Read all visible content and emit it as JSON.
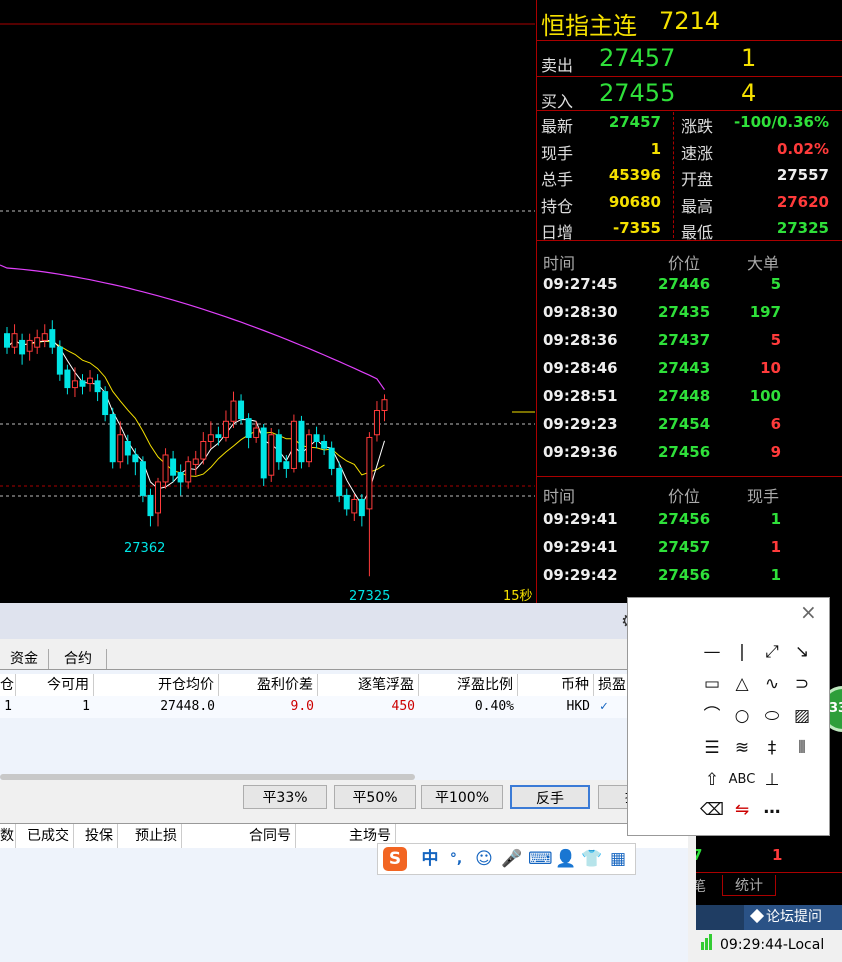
{
  "chart": {
    "labels": {
      "low1": "27362",
      "low2": "27325",
      "period": "15秒"
    },
    "candles": [
      {
        "o": 27505,
        "c": 27495,
        "h": 27510,
        "l": 27490
      },
      {
        "o": 27495,
        "c": 27505,
        "h": 27512,
        "l": 27490
      },
      {
        "o": 27500,
        "c": 27490,
        "h": 27505,
        "l": 27482
      },
      {
        "o": 27492,
        "c": 27500,
        "h": 27505,
        "l": 27485
      },
      {
        "o": 27495,
        "c": 27502,
        "h": 27508,
        "l": 27490
      },
      {
        "o": 27500,
        "c": 27505,
        "h": 27512,
        "l": 27495
      },
      {
        "o": 27508,
        "c": 27495,
        "h": 27515,
        "l": 27490
      },
      {
        "o": 27495,
        "c": 27475,
        "h": 27500,
        "l": 27470
      },
      {
        "o": 27478,
        "c": 27465,
        "h": 27482,
        "l": 27460
      },
      {
        "o": 27465,
        "c": 27470,
        "h": 27480,
        "l": 27458
      },
      {
        "o": 27470,
        "c": 27466,
        "h": 27475,
        "l": 27460
      },
      {
        "o": 27468,
        "c": 27472,
        "h": 27478,
        "l": 27462
      },
      {
        "o": 27470,
        "c": 27462,
        "h": 27475,
        "l": 27455
      },
      {
        "o": 27462,
        "c": 27445,
        "h": 27466,
        "l": 27440
      },
      {
        "o": 27445,
        "c": 27410,
        "h": 27450,
        "l": 27405
      },
      {
        "o": 27410,
        "c": 27430,
        "h": 27440,
        "l": 27405
      },
      {
        "o": 27425,
        "c": 27415,
        "h": 27430,
        "l": 27408
      },
      {
        "o": 27415,
        "c": 27410,
        "h": 27420,
        "l": 27400
      },
      {
        "o": 27410,
        "c": 27385,
        "h": 27414,
        "l": 27380
      },
      {
        "o": 27385,
        "c": 27370,
        "h": 27390,
        "l": 27362
      },
      {
        "o": 27372,
        "c": 27395,
        "h": 27398,
        "l": 27362
      },
      {
        "o": 27395,
        "c": 27415,
        "h": 27420,
        "l": 27390
      },
      {
        "o": 27412,
        "c": 27400,
        "h": 27418,
        "l": 27395
      },
      {
        "o": 27402,
        "c": 27395,
        "h": 27408,
        "l": 27385
      },
      {
        "o": 27395,
        "c": 27410,
        "h": 27414,
        "l": 27390
      },
      {
        "o": 27408,
        "c": 27412,
        "h": 27418,
        "l": 27400
      },
      {
        "o": 27412,
        "c": 27425,
        "h": 27432,
        "l": 27408
      },
      {
        "o": 27425,
        "c": 27430,
        "h": 27440,
        "l": 27420
      },
      {
        "o": 27430,
        "c": 27428,
        "h": 27436,
        "l": 27422
      },
      {
        "o": 27428,
        "c": 27440,
        "h": 27448,
        "l": 27425
      },
      {
        "o": 27440,
        "c": 27455,
        "h": 27462,
        "l": 27435
      },
      {
        "o": 27455,
        "c": 27442,
        "h": 27460,
        "l": 27438
      },
      {
        "o": 27442,
        "c": 27428,
        "h": 27446,
        "l": 27420
      },
      {
        "o": 27428,
        "c": 27435,
        "h": 27440,
        "l": 27424
      },
      {
        "o": 27435,
        "c": 27398,
        "h": 27438,
        "l": 27392
      },
      {
        "o": 27400,
        "c": 27430,
        "h": 27435,
        "l": 27395
      },
      {
        "o": 27430,
        "c": 27410,
        "h": 27434,
        "l": 27404
      },
      {
        "o": 27410,
        "c": 27405,
        "h": 27415,
        "l": 27398
      },
      {
        "o": 27405,
        "c": 27440,
        "h": 27445,
        "l": 27402
      },
      {
        "o": 27440,
        "c": 27410,
        "h": 27444,
        "l": 27405
      },
      {
        "o": 27410,
        "c": 27430,
        "h": 27434,
        "l": 27406
      },
      {
        "o": 27430,
        "c": 27425,
        "h": 27436,
        "l": 27420
      },
      {
        "o": 27425,
        "c": 27420,
        "h": 27430,
        "l": 27415
      },
      {
        "o": 27420,
        "c": 27405,
        "h": 27425,
        "l": 27400
      },
      {
        "o": 27405,
        "c": 27385,
        "h": 27410,
        "l": 27380
      },
      {
        "o": 27385,
        "c": 27375,
        "h": 27390,
        "l": 27370
      },
      {
        "o": 27372,
        "c": 27382,
        "h": 27386,
        "l": 27366
      },
      {
        "o": 27382,
        "c": 27370,
        "h": 27386,
        "l": 27362
      },
      {
        "o": 27375,
        "c": 27428,
        "h": 27432,
        "l": 27325
      },
      {
        "o": 27430,
        "c": 27448,
        "h": 27455,
        "l": 27425
      },
      {
        "o": 27448,
        "c": 27456,
        "h": 27460,
        "l": 27440
      }
    ]
  },
  "quote": {
    "title": "恒指主连",
    "code": "7214",
    "ask": {
      "label": "卖出",
      "price": "27457",
      "qty": "1"
    },
    "bid": {
      "label": "买入",
      "price": "27455",
      "qty": "4"
    },
    "stats": [
      {
        "l1": "最新",
        "v1": "27457",
        "c1": "green",
        "l2": "涨跌",
        "v2": "-100/0.36%",
        "c2": "green"
      },
      {
        "l1": "现手",
        "v1": "1",
        "c1": "yellow",
        "l2": "速涨",
        "v2": "0.02%",
        "c2": "red"
      },
      {
        "l1": "总手",
        "v1": "45396",
        "c1": "yellow",
        "l2": "开盘",
        "v2": "27557",
        "c2": "white"
      },
      {
        "l1": "持仓",
        "v1": "90680",
        "c1": "yellow",
        "l2": "最高",
        "v2": "27620",
        "c2": "red"
      },
      {
        "l1": "日增",
        "v1": "-7355",
        "c1": "yellow",
        "l2": "最低",
        "v2": "27325",
        "c2": "green"
      }
    ],
    "big_orders": {
      "headers": {
        "time": "时间",
        "price": "价位",
        "size": "大单"
      },
      "rows": [
        {
          "time": "09:27:45",
          "price": "27446",
          "size": "5",
          "c": "green"
        },
        {
          "time": "09:28:30",
          "price": "27435",
          "size": "197",
          "c": "green"
        },
        {
          "time": "09:28:36",
          "price": "27437",
          "size": "5",
          "c": "red"
        },
        {
          "time": "09:28:46",
          "price": "27443",
          "size": "10",
          "c": "red"
        },
        {
          "time": "09:28:51",
          "price": "27448",
          "size": "100",
          "c": "green"
        },
        {
          "time": "09:29:23",
          "price": "27454",
          "size": "6",
          "c": "red"
        },
        {
          "time": "09:29:36",
          "price": "27456",
          "size": "9",
          "c": "red"
        }
      ]
    },
    "ticks": {
      "headers": {
        "time": "时间",
        "price": "价位",
        "size": "现手"
      },
      "rows": [
        {
          "time": "09:29:41",
          "price": "27456",
          "size": "1",
          "c": "green"
        },
        {
          "time": "09:29:41",
          "price": "27457",
          "size": "1",
          "c": "red"
        },
        {
          "time": "09:29:42",
          "price": "27456",
          "size": "1",
          "c": "green"
        }
      ]
    },
    "bottom_row": {
      "price_tail": "7",
      "size": "1"
    },
    "bottom_tabs": {
      "tab1": "笔",
      "tab2": "统计"
    },
    "forum_button": "论坛提问",
    "clock": "09:29:44-Local",
    "bubble": "33"
  },
  "trade": {
    "tabs": [
      "资金",
      "合约"
    ],
    "columns": [
      "仓",
      "今可用",
      "开仓均价",
      "盈利价差",
      "逐笔浮盈",
      "浮盈比例",
      "币种",
      "损盈"
    ],
    "row": [
      "1",
      "1",
      "27448.0",
      "9.0",
      "450",
      "0.40%",
      "HKD",
      "✓"
    ],
    "buttons": [
      "平33%",
      "平50%",
      "平100%",
      "反手",
      "损盈"
    ],
    "order_columns": [
      "数",
      "已成交",
      "投保",
      "预止损",
      "合同号",
      "主场号"
    ]
  },
  "ime": {
    "logo": "S",
    "mode": "中",
    "punct": "°,"
  },
  "tools": {
    "abc": "ABC",
    "more": "…",
    "close": "×"
  },
  "colors": {
    "up": "#ff3b3b",
    "down": "#00e5e5",
    "ma_long": "#e040fb",
    "ma_short": "#ffffff",
    "ma_mid": "#f5e000",
    "accent_green": "#2fe03a"
  }
}
